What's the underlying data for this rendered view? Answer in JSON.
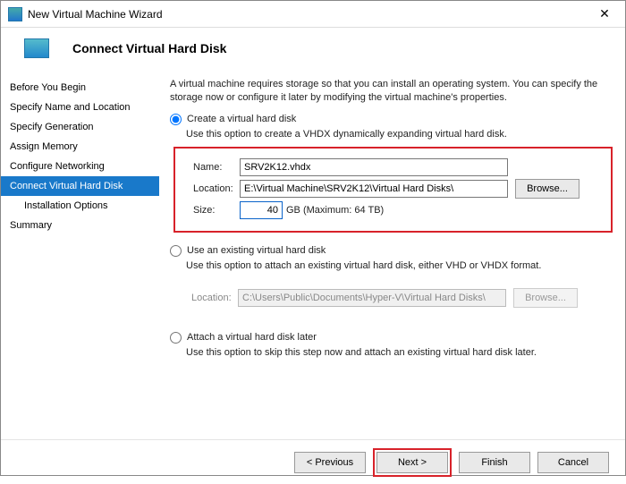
{
  "window": {
    "title": "New Virtual Machine Wizard",
    "close_glyph": "✕"
  },
  "header": {
    "title": "Connect Virtual Hard Disk"
  },
  "sidebar": {
    "items": [
      {
        "label": "Before You Begin",
        "selected": false,
        "sub": false
      },
      {
        "label": "Specify Name and Location",
        "selected": false,
        "sub": false
      },
      {
        "label": "Specify Generation",
        "selected": false,
        "sub": false
      },
      {
        "label": "Assign Memory",
        "selected": false,
        "sub": false
      },
      {
        "label": "Configure Networking",
        "selected": false,
        "sub": false
      },
      {
        "label": "Connect Virtual Hard Disk",
        "selected": true,
        "sub": false
      },
      {
        "label": "Installation Options",
        "selected": false,
        "sub": true
      },
      {
        "label": "Summary",
        "selected": false,
        "sub": false
      }
    ]
  },
  "content": {
    "intro": "A virtual machine requires storage so that you can install an operating system. You can specify the storage now or configure it later by modifying the virtual machine's properties.",
    "opt_create": {
      "label": "Create a virtual hard disk",
      "desc": "Use this option to create a VHDX dynamically expanding virtual hard disk.",
      "name_label": "Name:",
      "name_value": "SRV2K12.vhdx",
      "loc_label": "Location:",
      "loc_value": "E:\\Virtual Machine\\SRV2K12\\Virtual Hard Disks\\",
      "browse_label": "Browse...",
      "size_label": "Size:",
      "size_value": "40",
      "size_suffix": "GB (Maximum: 64 TB)"
    },
    "opt_existing": {
      "label": "Use an existing virtual hard disk",
      "desc": "Use this option to attach an existing virtual hard disk, either VHD or VHDX format.",
      "loc_label": "Location:",
      "loc_value": "C:\\Users\\Public\\Documents\\Hyper-V\\Virtual Hard Disks\\",
      "browse_label": "Browse..."
    },
    "opt_later": {
      "label": "Attach a virtual hard disk later",
      "desc": "Use this option to skip this step now and attach an existing virtual hard disk later."
    }
  },
  "footer": {
    "previous": "< Previous",
    "next": "Next >",
    "finish": "Finish",
    "cancel": "Cancel"
  }
}
